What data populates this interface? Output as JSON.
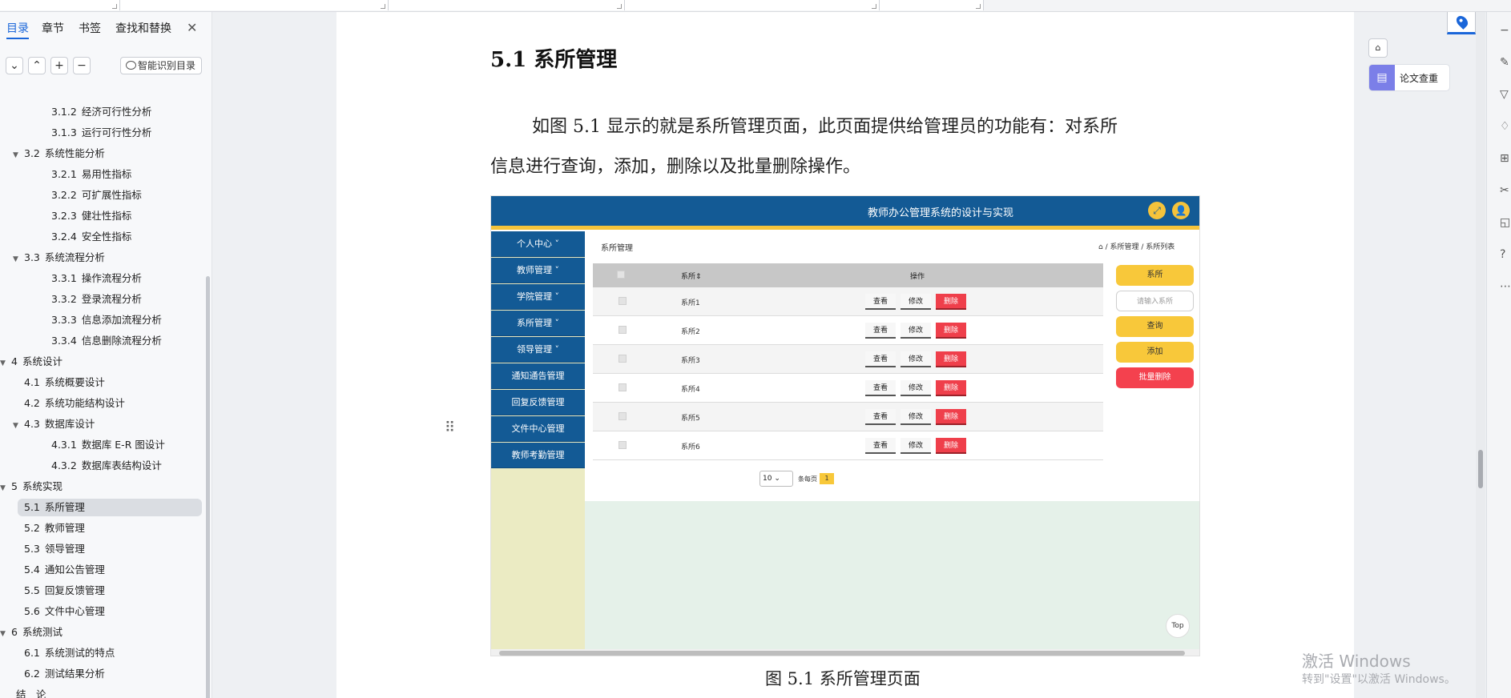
{
  "nav": {
    "tabs": [
      "目录",
      "章节",
      "书签",
      "查找和替换"
    ],
    "close": "✕",
    "tools": [
      "⌄",
      "⌃",
      "+",
      "−"
    ],
    "smart_toc": "智能识别目录",
    "items": [
      {
        "num": "3.1.2",
        "label": "经济可行性分析",
        "level": 3,
        "expander": false
      },
      {
        "num": "3.1.3",
        "label": "运行可行性分析",
        "level": 3,
        "expander": false
      },
      {
        "num": "3.2",
        "label": "系统性能分析",
        "level": 2,
        "expander": true
      },
      {
        "num": "3.2.1",
        "label": "易用性指标",
        "level": 3,
        "expander": false
      },
      {
        "num": "3.2.2",
        "label": "可扩展性指标",
        "level": 3,
        "expander": false
      },
      {
        "num": "3.2.3",
        "label": "健壮性指标",
        "level": 3,
        "expander": false
      },
      {
        "num": "3.2.4",
        "label": "安全性指标",
        "level": 3,
        "expander": false
      },
      {
        "num": "3.3",
        "label": "系统流程分析",
        "level": 2,
        "expander": true
      },
      {
        "num": "3.3.1",
        "label": "操作流程分析",
        "level": 3,
        "expander": false
      },
      {
        "num": "3.3.2",
        "label": "登录流程分析",
        "level": 3,
        "expander": false
      },
      {
        "num": "3.3.3",
        "label": "信息添加流程分析",
        "level": 3,
        "expander": false
      },
      {
        "num": "3.3.4",
        "label": "信息删除流程分析",
        "level": 3,
        "expander": false
      },
      {
        "num": "4",
        "label": "系统设计",
        "level": 1,
        "expander": true
      },
      {
        "num": "4.1",
        "label": "系统概要设计",
        "level": 2,
        "expander": false
      },
      {
        "num": "4.2",
        "label": "系统功能结构设计",
        "level": 2,
        "expander": false
      },
      {
        "num": "4.3",
        "label": "数据库设计",
        "level": 2,
        "expander": true
      },
      {
        "num": "4.3.1",
        "label": "数据库 E-R 图设计",
        "level": 3,
        "expander": false
      },
      {
        "num": "4.3.2",
        "label": "数据库表结构设计",
        "level": 3,
        "expander": false
      },
      {
        "num": "5",
        "label": "系统实现",
        "level": 1,
        "expander": true
      },
      {
        "num": "5.1",
        "label": "系所管理",
        "level": 2,
        "expander": false,
        "active": true
      },
      {
        "num": "5.2",
        "label": "教师管理",
        "level": 2,
        "expander": false
      },
      {
        "num": "5.3",
        "label": "领导管理",
        "level": 2,
        "expander": false
      },
      {
        "num": "5.4",
        "label": "通知公告管理",
        "level": 2,
        "expander": false
      },
      {
        "num": "5.5",
        "label": "回复反馈管理",
        "level": 2,
        "expander": false
      },
      {
        "num": "5.6",
        "label": "文件中心管理",
        "level": 2,
        "expander": false
      },
      {
        "num": "6",
        "label": "系统测试",
        "level": 1,
        "expander": true
      },
      {
        "num": "6.1",
        "label": "系统测试的特点",
        "level": 2,
        "expander": false
      },
      {
        "num": "6.2",
        "label": "测试结果分析",
        "level": 2,
        "expander": false
      },
      {
        "num": "",
        "label": "结　论",
        "level": 1,
        "expander": false
      }
    ]
  },
  "doc": {
    "heading": "5.1  系所管理",
    "para_line1": "如图 5.1 显示的就是系所管理页面，此页面提供给管理员的功能有：对系所",
    "para_line2": "信息进行查询，添加，删除以及批量删除操作。",
    "caption": "图 5.1  系所管理页面",
    "drag_handle": "⠿"
  },
  "figure": {
    "app_title": "教师办公管理系统的设计与实现",
    "header_icons": [
      "⤢",
      "👤"
    ],
    "menu": [
      "个人中心 ˅",
      "教师管理 ˅",
      "学院管理 ˅",
      "系所管理 ˅",
      "领导管理 ˅",
      "通知通告管理",
      "回复反馈管理",
      "文件中心管理",
      "教师考勤管理"
    ],
    "crumb_left": "系所管理",
    "crumb_right": "⌂ / 系所管理 / 系所列表",
    "col_name": "系所⇕",
    "col_ops": "操作",
    "rows": [
      "系所1",
      "系所2",
      "系所3",
      "系所4",
      "系所5",
      "系所6"
    ],
    "btn_view": "查看",
    "btn_edit": "修改",
    "btn_del": "删除",
    "right_buttons": {
      "label": "系所",
      "placeholder": "请输入系所",
      "query": "查询",
      "add": "添加",
      "batch_delete": "批量删除"
    },
    "pager_size": "10 ⌄",
    "pager_text": "条每页",
    "pager_page": "1",
    "top_btn": "Top"
  },
  "right_panel": {
    "collapse": "⌂",
    "plag_check": "论文查重",
    "plag_icon": "▤"
  },
  "watermark": {
    "line1": "激活 Windows",
    "line2": "转到\"设置\"以激活 Windows。"
  },
  "right_toolbar_icons": [
    "−",
    "✎",
    "▽",
    "♢",
    "⊞",
    "✂",
    "◱",
    "?",
    "⋯"
  ]
}
